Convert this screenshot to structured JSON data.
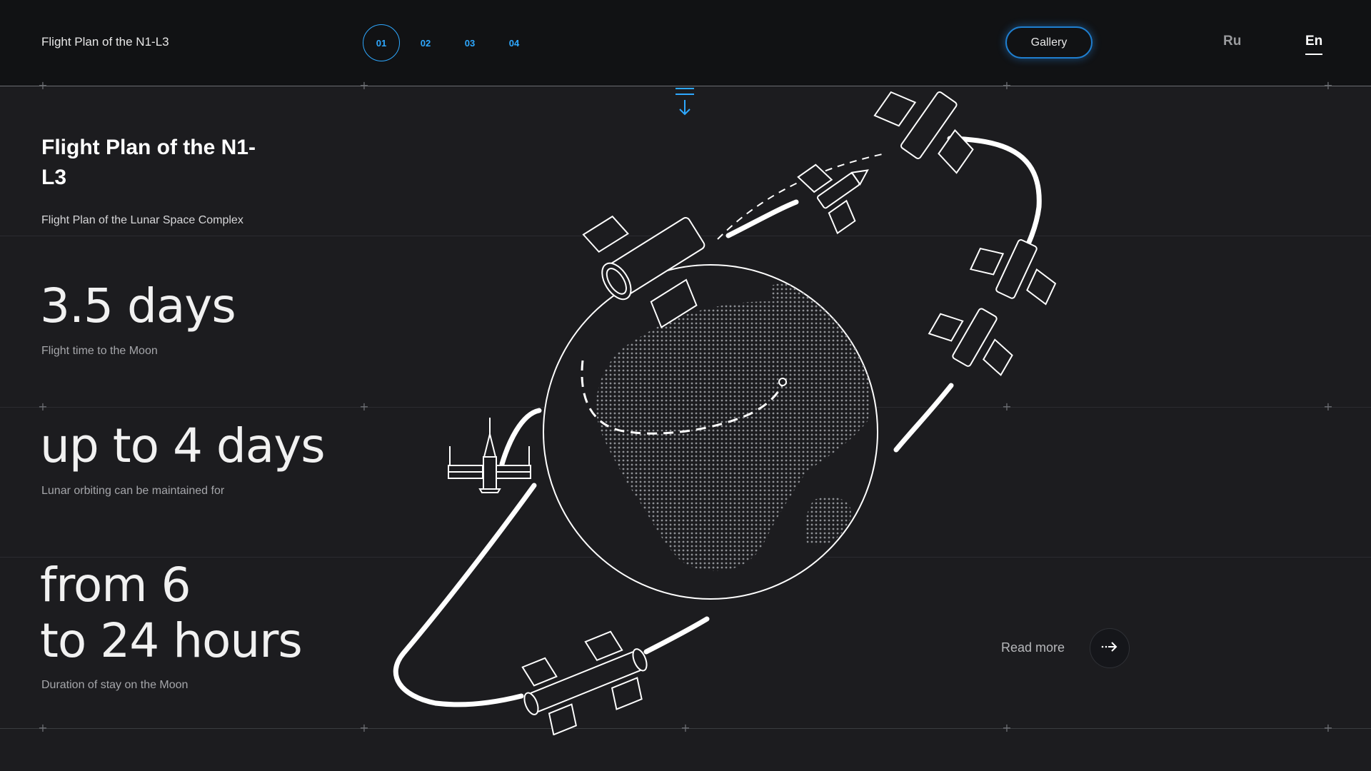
{
  "header": {
    "site_title": "Flight Plan of the N1-L3",
    "steps": [
      {
        "label": "01",
        "active": true
      },
      {
        "label": "02",
        "active": false
      },
      {
        "label": "03",
        "active": false
      },
      {
        "label": "04",
        "active": false
      }
    ],
    "gallery_label": "Gallery",
    "languages": [
      {
        "label": "Ru",
        "active": false
      },
      {
        "label": "En",
        "active": true
      }
    ]
  },
  "hero": {
    "title": "Flight Plan of the N1-L3",
    "subtitle": "Flight Plan of the Lunar Space Complex"
  },
  "stats": [
    {
      "value": "3.5 days",
      "caption": "Flight time to the Moon"
    },
    {
      "value": "up to 4 days",
      "caption": "Lunar orbiting can be maintained for"
    },
    {
      "value_lines": [
        "from 6",
        "to 24 hours"
      ],
      "caption": "Duration of stay on the Moon"
    }
  ],
  "read_more": {
    "label": "Read more"
  },
  "icons": {
    "scroll": "scroll-down-icon",
    "arrow": "arrow-right-icon",
    "globe": "earth-globe-icon",
    "spacecraft": "spacecraft-icon"
  },
  "colors": {
    "background": "#1c1c1f",
    "header": "#111214",
    "accent": "#2ea8ff",
    "text": "#ffffff",
    "muted": "#a5a6aa"
  }
}
